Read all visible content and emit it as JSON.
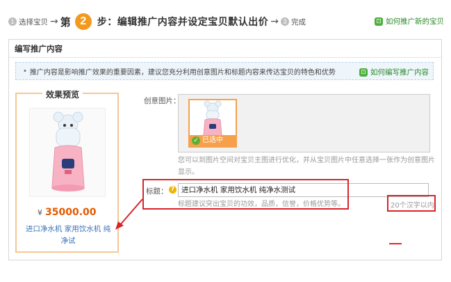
{
  "steps": {
    "step1_num": "1",
    "step1_label": "选择宝贝",
    "step2_prefix": "第",
    "step2_num": "2",
    "step2_title": "步：编辑推广内容并设定宝贝默认出价",
    "step3_num": "3",
    "step3_label": "完成",
    "help_link": "如何推广新的宝贝"
  },
  "panel": {
    "header": "编写推广内容",
    "notice_text": "推广内容是影响推广效果的重要因素，建议您充分利用创意图片和标题内容来传达宝贝的特色和优势",
    "notice_help": "如何编写推广内容"
  },
  "preview": {
    "title": "效果预览",
    "currency": "¥",
    "price": "35000.00",
    "link_text": "进口净水机 家用饮水机 纯净试"
  },
  "form": {
    "creative_label": "创意图片：",
    "selected_label": "已选中",
    "creative_hint": "您可以到图片空间对宝贝主图进行优化，并从宝贝图片中任意选择一张作为创意图片显示。",
    "title_label": "标题：",
    "title_value": "进口净水机 家用饮水机 纯净水测试",
    "title_hint": "标题建议突出宝贝的功效，品质，信誉，价格优势等。",
    "title_limit": "20个汉字以内"
  },
  "colors": {
    "accent_orange": "#f39a1e",
    "price_orange": "#e35b00",
    "link_blue": "#3b73b9",
    "help_green": "#2b8a2b",
    "annotation_red": "#d9232a"
  }
}
